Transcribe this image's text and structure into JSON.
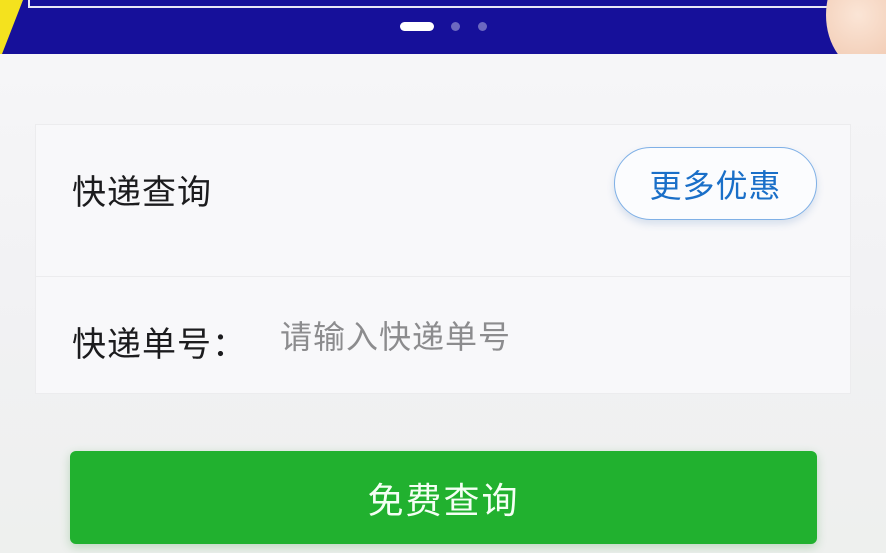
{
  "banner": {
    "carousel": {
      "active_index": 0,
      "count": 3
    },
    "colors": {
      "background": "#16109a",
      "accent": "#f4e21e"
    }
  },
  "query_card": {
    "title": "快递查询",
    "promo_button_label": "更多优惠",
    "tracking_field": {
      "label": "快递单号：",
      "placeholder": "请输入快递单号",
      "value": ""
    }
  },
  "submit_button_label": "免费查询",
  "colors": {
    "primary": "#21b12f",
    "link": "#1a6fc8"
  }
}
